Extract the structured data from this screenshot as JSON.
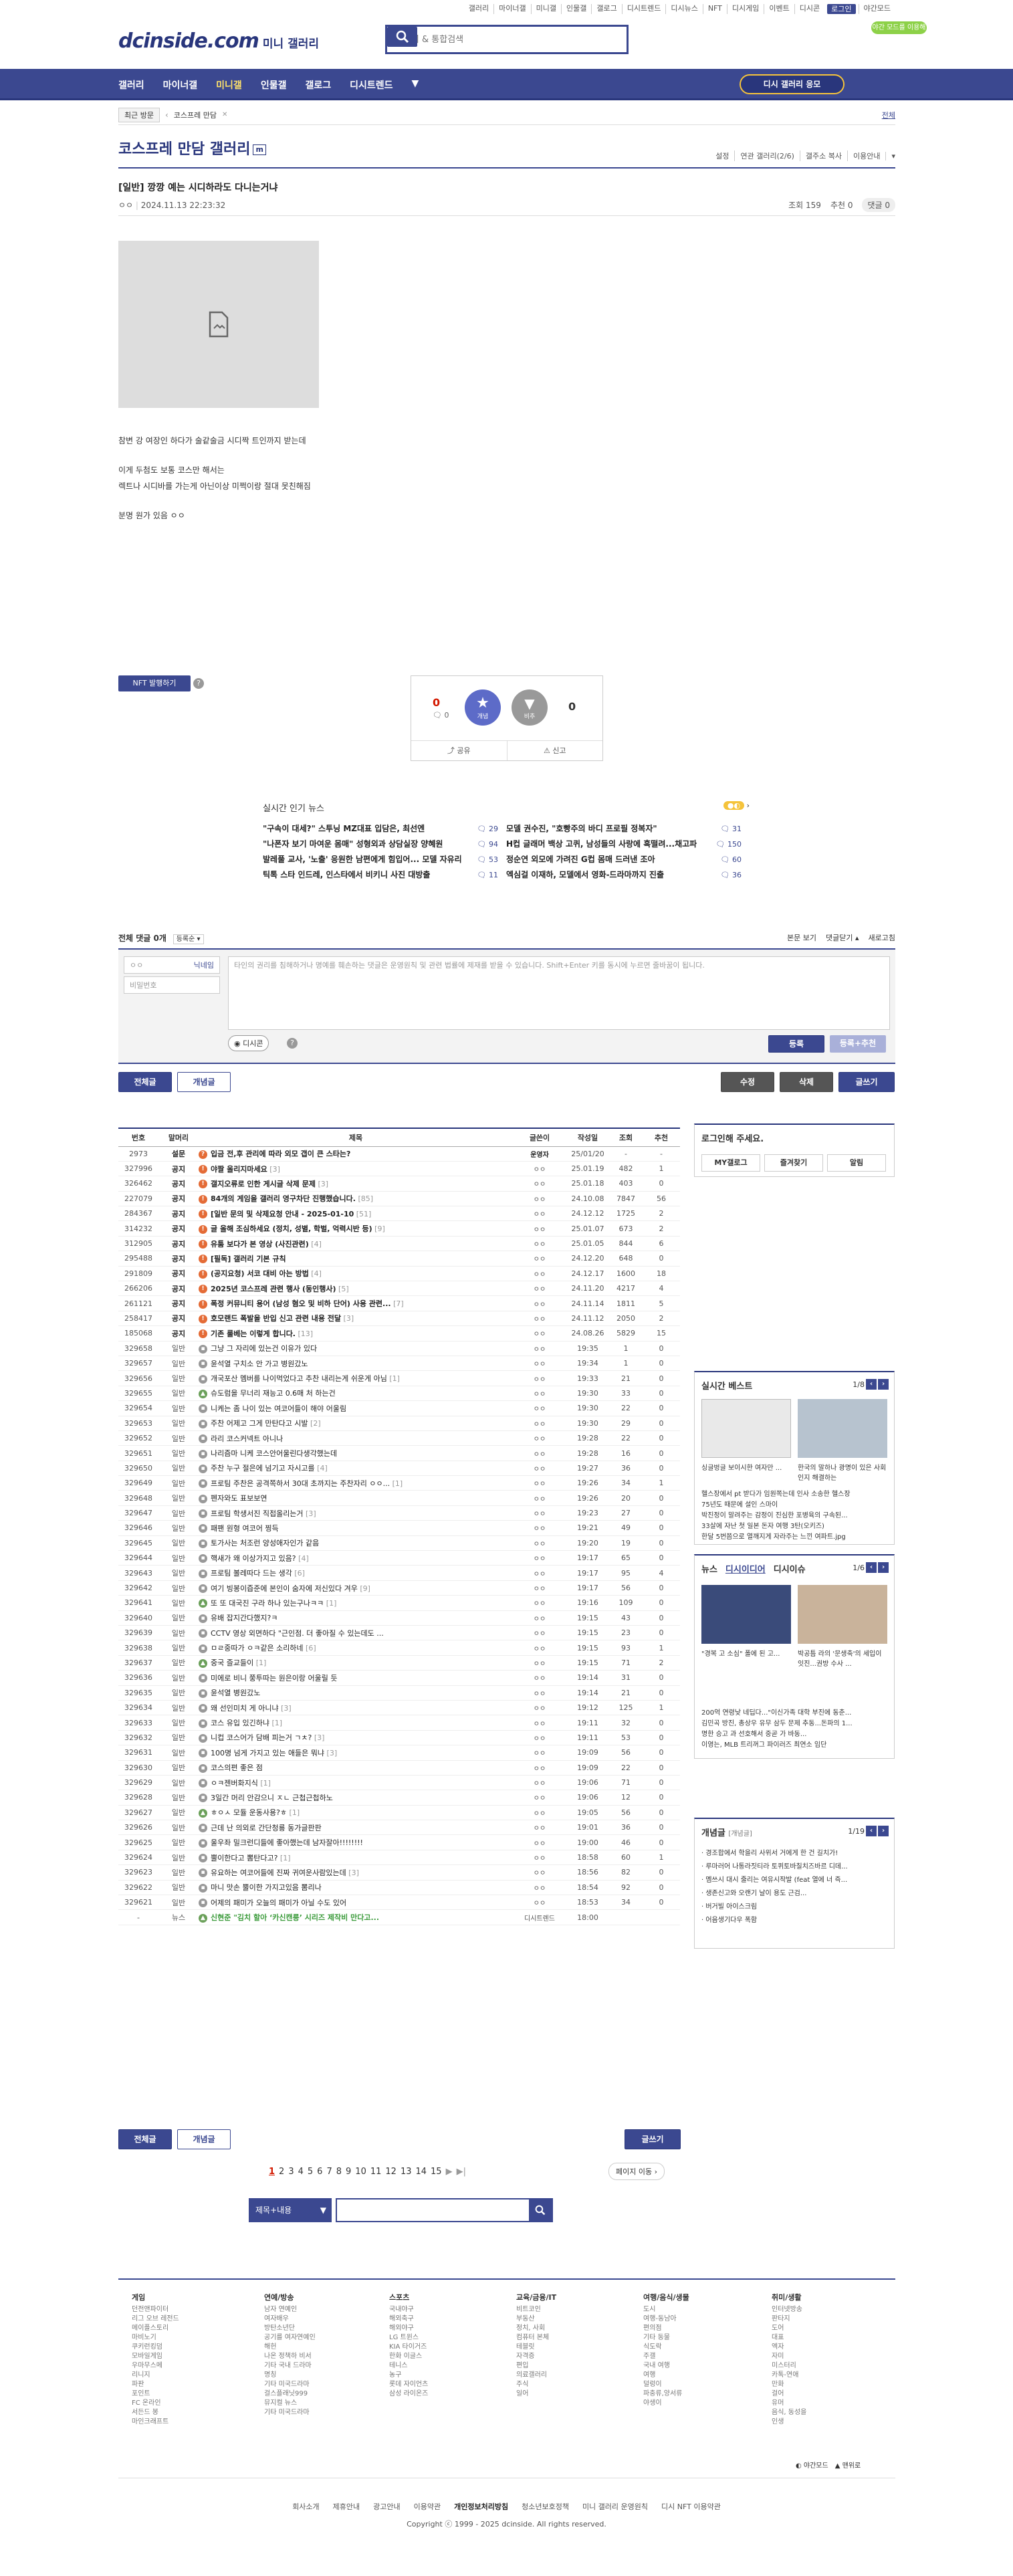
{
  "top_util": [
    "갤러리",
    "마이너갤",
    "미니갤",
    "인물갤",
    "갤로그",
    "디시트렌드",
    "디시뉴스",
    "NFT",
    "디시게임",
    "이벤트",
    "디시콘",
    "로그인",
    "야간모드"
  ],
  "promo": "야간 모드를 이용해 보세요",
  "logo": {
    "brand": "dcinside.com",
    "sub": "미니 갤러리"
  },
  "search": {
    "placeholder": "갤러리 & 통합검색"
  },
  "gnb": {
    "items": [
      "갤러리",
      "마이너갤",
      "미니갤",
      "인물갤",
      "갤로그",
      "디시트렌드"
    ],
    "cta": "디시 갤러리 응모"
  },
  "recent": {
    "tag": "최근 방문",
    "item": "코스프레 만담",
    "more": "전체"
  },
  "gallery": {
    "title": "코스프레 만담 갤러리",
    "badge": "m",
    "tools": [
      "설정",
      "연관 갤러리(2/6)",
      "갤주소 복사",
      "이용안내"
    ]
  },
  "post": {
    "title": "[일반] 깡깡 예는 시디하라도 다니는거냐",
    "author": "ㅇㅇ",
    "date": "2024.11.13 22:23:32",
    "views": "조회 159",
    "recs": "추천 0",
    "comments": "댓글 0",
    "body": [
      "참변 강 여장인 하다가 술같술금 시디짝 트인까지 받는데",
      "이게 두첨도 보통 코스만 해서는",
      "렉트나 시디바를 가는게 아닌이상 미쩍이랑 절대 못친해짐",
      "분명 원가 있음 ㅇㅇ"
    ]
  },
  "nft": "NFT 발행하기",
  "vote": {
    "up": "0",
    "fix": "0",
    "down": "0",
    "up_label": "개념",
    "down_label": "비추",
    "share": "공유",
    "report": "신고"
  },
  "news": {
    "title": "실시간 인기 뉴스",
    "items": [
      {
        "t": "\"구속이 대세?\" 스투닝 MZ대표 입담은, 최선엔",
        "c": "29"
      },
      {
        "t": "모델 권수진, \"호빵주의 바디 프로필 정복자\"",
        "c": "31"
      },
      {
        "t": "\"나폰자 보기 마여운 몸매\" 성형외과 상담실장 양혜원",
        "c": "94"
      },
      {
        "t": "H컵 글래머 백상 고퀴, 남성들의 사랑에 혹떨려...채고파",
        "c": "150"
      },
      {
        "t": "발레풀 교사, '노출' 응원한 남편에게 힘입어... 모델 자유리",
        "c": "53"
      },
      {
        "t": "정순연 외모에 가려진 G컵 몸매 드러낸 조아",
        "c": "60"
      },
      {
        "t": "틱톡 스타 인드레, 인스타에서 비키니 사진 대방출",
        "c": "11"
      },
      {
        "t": "엑심걸 이재하, 모델에서 영화-드라마까지 진출",
        "c": "36"
      }
    ]
  },
  "comments": {
    "title": "전체 댓글 0개",
    "sort": "등록순",
    "view": "본문 보기",
    "fold": "댓글닫기",
    "refresh": "새로고침",
    "name_ph": "ㅇㅇ",
    "pw_ph": "비밀번호",
    "nick": "닉네임",
    "input_ph": "타인의 권리를 침해하거나 명예를 훼손하는 댓글은 운영원칙 및 관련 법률에 제재를 받을 수 있습니다. Shift+Enter 키를 동시에 누르면 줄바꿈이 됩니다.",
    "dcon": "디시콘",
    "submit": "등록",
    "submit_rec": "등록+추천"
  },
  "actions": {
    "all": "전체글",
    "concept": "개념글",
    "edit": "수정",
    "delete": "삭제",
    "write": "글쓰기"
  },
  "list": {
    "headers": [
      "번호",
      "말머리",
      "제목",
      "글쓴이",
      "작성일",
      "조회",
      "추천"
    ],
    "rows": [
      [
        "2973",
        "설문",
        "입금 전,후 관리에 따라 외모 갭이 큰 스타는?",
        "운영자",
        "25/01/20",
        "-",
        "-",
        "s",
        "b",
        ""
      ],
      [
        "327996",
        "공지",
        "야짤 올리지마세요",
        "ㅇㅇ",
        "25.01.19",
        "482",
        "1",
        "n",
        "b",
        "3"
      ],
      [
        "326462",
        "공지",
        "갤지오류로 인한 게시글 삭제 문제",
        "ㅇㅇ",
        "25.01.18",
        "403",
        "0",
        "n",
        "b",
        "3"
      ],
      [
        "227079",
        "공지",
        "84개의 게임을 갤러리 영구차단 진행했습니다.",
        "ㅇㅇ",
        "24.10.08",
        "7847",
        "56",
        "n",
        "b",
        "85"
      ],
      [
        "284367",
        "공지",
        "[일반 문의 및 삭제요청 안내 - 2025-01-10",
        "ㅇㅇ",
        "24.12.12",
        "1725",
        "2",
        "n",
        "b",
        "51"
      ],
      [
        "314232",
        "공지",
        "글 올해 조심하세요 (정치, 성별, 학벌, 억력시반 등)",
        "ㅇㅇ",
        "25.01.07",
        "673",
        "2",
        "n",
        "b",
        "9"
      ],
      [
        "312905",
        "공지",
        "유툼 보다가 본 영상 (사진관련)",
        "ㅇㅇ",
        "25.01.05",
        "844",
        "6",
        "n",
        "b",
        "4"
      ],
      [
        "295488",
        "공지",
        "[필독] 갤러리 기본 규칙",
        "ㅇㅇ",
        "24.12.20",
        "648",
        "0",
        "n",
        "b",
        ""
      ],
      [
        "291809",
        "공지",
        "(공지요청) 서코 대비 아는 방법",
        "ㅇㅇ",
        "24.12.17",
        "1600",
        "18",
        "n",
        "b",
        "4"
      ],
      [
        "266206",
        "공지",
        "2025년 코스프레 관련 행사 (동인행사)",
        "ㅇㅇ",
        "24.11.20",
        "4217",
        "4",
        "n",
        "b",
        "5"
      ],
      [
        "261121",
        "공지",
        "폭정 커뮤니티 용어 (남성 혐오 및 비하 단어) 사용 관련...",
        "ㅇㅇ",
        "24.11.14",
        "1811",
        "5",
        "n",
        "b",
        "7"
      ],
      [
        "258417",
        "공지",
        "호모랜드 폭발을 반입 신고 관련 내용 전달",
        "ㅇㅇ",
        "24.11.12",
        "2050",
        "2",
        "n",
        "b",
        "3"
      ],
      [
        "185068",
        "공지",
        "기존 룰베는 이렇게 합니다.",
        "ㅇㅇ",
        "24.08.26",
        "5829",
        "15",
        "n",
        "b",
        "13"
      ],
      [
        "329658",
        "일반",
        "그냥 그 자리에 있는건 이유가 있다",
        "ㅇㅇ",
        "19:35",
        "1",
        "0",
        "p",
        "",
        ""
      ],
      [
        "329657",
        "일반",
        "윤석열 구치소 안 가고 병원갔노",
        "ㅇㅇ",
        "19:34",
        "1",
        "0",
        "p",
        "",
        ""
      ],
      [
        "329656",
        "일반",
        "개국포산 멤버를 나이먹었다고 추찬 내리는게 쉬운게 아님",
        "ㅇㅇ",
        "19:33",
        "21",
        "0",
        "p",
        "",
        "1"
      ],
      [
        "329655",
        "일반",
        "슈도럼을 무너리 재능고 0.6매 처 하는건",
        "ㅇㅇ",
        "19:30",
        "33",
        "0",
        "i",
        "",
        ""
      ],
      [
        "329654",
        "일반",
        "니케는 좀 나이 있는 여코어들이 해야 어울림",
        "ㅇㅇ",
        "19:30",
        "22",
        "0",
        "p",
        "",
        ""
      ],
      [
        "329653",
        "일반",
        "주찬 어제고 그게 만탄다고 시발",
        "ㅇㅇ",
        "19:30",
        "29",
        "0",
        "p",
        "",
        "2"
      ],
      [
        "329652",
        "일반",
        "라리 코스커넥트 아니나",
        "ㅇㅇ",
        "19:28",
        "22",
        "0",
        "p",
        "",
        ""
      ],
      [
        "329651",
        "일반",
        "나리즘마 니케 코스안어울린다생각했는데",
        "ㅇㅇ",
        "19:28",
        "16",
        "0",
        "p",
        "",
        ""
      ],
      [
        "329650",
        "일반",
        "주찬 누구 절은에 넘기고 자시고를",
        "ㅇㅇ",
        "19:27",
        "36",
        "0",
        "p",
        "",
        "4"
      ],
      [
        "329649",
        "일반",
        "프로팀 주찬은 공격쪽하서 30대 초까지는 주찬자리 ㅇㅇ...",
        "ㅇㅇ",
        "19:26",
        "34",
        "1",
        "p",
        "",
        "1"
      ],
      [
        "329648",
        "일반",
        "펜자와도 표보보연",
        "ㅇㅇ",
        "19:26",
        "20",
        "0",
        "p",
        "",
        ""
      ],
      [
        "329647",
        "일반",
        "프로팀 학생서진 직접올리는거",
        "ㅇㅇ",
        "19:23",
        "27",
        "0",
        "p",
        "",
        "3"
      ],
      [
        "329646",
        "일반",
        "패팬 원형 여코어 찡득",
        "ㅇㅇ",
        "19:21",
        "49",
        "0",
        "p",
        "",
        ""
      ],
      [
        "329645",
        "일반",
        "토가사는 처조런 양성애자인가 같음",
        "ㅇㅇ",
        "19:20",
        "19",
        "0",
        "p",
        "",
        ""
      ],
      [
        "329644",
        "일반",
        "핵새가 왜 이상가지고 있음?",
        "ㅇㅇ",
        "19:17",
        "65",
        "0",
        "p",
        "",
        "4"
      ],
      [
        "329643",
        "일반",
        "프로팀 볼레따다 드는 생각",
        "ㅇㅇ",
        "19:17",
        "95",
        "4",
        "p",
        "",
        "6"
      ],
      [
        "329642",
        "일반",
        "여기 빙봉이즙준에 본인이 숨자에 저신있다 겨우",
        "ㅇㅇ",
        "19:17",
        "56",
        "0",
        "p",
        "",
        "9"
      ],
      [
        "329641",
        "일반",
        "또 또 대국진 구라 하나 있는구나ㅋㅋ",
        "ㅇㅇ",
        "19:16",
        "109",
        "0",
        "i",
        "",
        "1"
      ],
      [
        "329640",
        "일반",
        "유배 잡지간다했지?ㅋ",
        "ㅇㅇ",
        "19:15",
        "43",
        "0",
        "p",
        "",
        ""
      ],
      [
        "329639",
        "일반",
        "CCTV 영상 외면하다 \"근인점. 더 좋아질 수 있는데도 ...",
        "ㅇㅇ",
        "19:15",
        "23",
        "0",
        "p",
        "",
        ""
      ],
      [
        "329638",
        "일반",
        "ㅁㄹ중따가 ㅇㅋ같은 소리하네",
        "ㅇㅇ",
        "19:15",
        "93",
        "1",
        "p",
        "",
        "6"
      ],
      [
        "329637",
        "일반",
        "중국 즐교들이",
        "ㅇㅇ",
        "19:15",
        "71",
        "2",
        "i",
        "",
        "1"
      ],
      [
        "329636",
        "일반",
        "미에로 비니 쭝투따는 원은이랑 어울릴 듯",
        "ㅇㅇ",
        "19:14",
        "31",
        "0",
        "p",
        "",
        ""
      ],
      [
        "329635",
        "일반",
        "윤석열 병원갔노",
        "ㅇㅇ",
        "19:14",
        "21",
        "0",
        "p",
        "",
        ""
      ],
      [
        "329634",
        "일반",
        "왜 선인미치 게 아니냐",
        "ㅇㅇ",
        "19:12",
        "125",
        "1",
        "p",
        "",
        "3"
      ],
      [
        "329633",
        "일반",
        "코스 유입 있긴하냐",
        "ㅇㅇ",
        "19:11",
        "32",
        "0",
        "p",
        "",
        "1"
      ],
      [
        "329632",
        "일반",
        "니컵 코스어가 담배 피는거 ㄱㅊ?",
        "ㅇㅇ",
        "19:11",
        "53",
        "0",
        "p",
        "",
        "3"
      ],
      [
        "329631",
        "일반",
        "100명 넘게 가지고 있는 애들은 뭐냐",
        "ㅇㅇ",
        "19:09",
        "56",
        "0",
        "p",
        "",
        "3"
      ],
      [
        "329630",
        "일반",
        "코스의편 좋은 점",
        "ㅇㅇ",
        "19:09",
        "22",
        "0",
        "p",
        "",
        ""
      ],
      [
        "329629",
        "일반",
        "ㅇㅋ젠버화지식",
        "ㅇㅇ",
        "19:06",
        "71",
        "0",
        "p",
        "",
        "1"
      ],
      [
        "329628",
        "일반",
        "3일간 머리 안감으니 ㅈㄴ 근첩근첩하노",
        "ㅇㅇ",
        "19:06",
        "12",
        "0",
        "p",
        "",
        ""
      ],
      [
        "329627",
        "일반",
        "ㅎㅇㅅ 모듈 운동사용?ㅎ",
        "ㅇㅇ",
        "19:05",
        "56",
        "0",
        "i",
        "",
        "1"
      ],
      [
        "329626",
        "일반",
        "근데 난 의외로 간단청룡 동가글판판",
        "ㅇㅇ",
        "19:01",
        "36",
        "0",
        "p",
        "",
        ""
      ],
      [
        "329625",
        "일반",
        "울우좌 밀크런디들에 좋아했는데 남자잘아!!!!!!!!",
        "ㅇㅇ",
        "19:00",
        "46",
        "0",
        "p",
        "",
        ""
      ],
      [
        "329624",
        "일반",
        "뿔이한다고 뽐탄다고?",
        "ㅇㅇ",
        "18:58",
        "60",
        "1",
        "p",
        "",
        "1"
      ],
      [
        "329623",
        "일반",
        "유요하는 여코어들에 진짜 귀여운사람있는데",
        "ㅇㅇ",
        "18:56",
        "82",
        "0",
        "p",
        "",
        "3"
      ],
      [
        "329622",
        "일반",
        "마니 맛손 뿔이한 가지고있음 뽐리나",
        "ㅇㅇ",
        "18:54",
        "92",
        "0",
        "p",
        "",
        ""
      ],
      [
        "329621",
        "일반",
        "어제의 패미가 오늘의 패미가 아닐 수도 있어",
        "ㅇㅇ",
        "18:53",
        "34",
        "0",
        "p",
        "",
        ""
      ],
      [
        "-",
        "뉴스",
        "신현준 \"김치 할아 ‘카신캔릉’ 시리즈 제작비 만다고...",
        "디시트렌드",
        "18:00",
        "",
        "",
        "i",
        "b",
        ""
      ]
    ]
  },
  "pagination": {
    "pages": [
      "1",
      "2",
      "3",
      "4",
      "5",
      "6",
      "7",
      "8",
      "9",
      "10",
      "11",
      "12",
      "13",
      "14",
      "15"
    ],
    "move": "페이지 이동"
  },
  "search_bottom": {
    "option": "제목+내용"
  },
  "login": {
    "title": "로그인해 주세요.",
    "btns": [
      "MY갤로그",
      "즐겨찾기",
      "알림"
    ]
  },
  "best": {
    "title": "실시간 베스트",
    "page": "1/8",
    "caps": [
      "싱글벙글 보이시한 여자만 ...",
      "한국의 말하나 광명이 있은 사회인지 해결하는"
    ],
    "items": [
      "헬스장에서 pt 받다가 임원쪽는데 인사 소송한 헬스장",
      "75년도 때문에 설인 스마이",
      "박진정이 말려주는 감정이 진심한 포병육의 구속된...",
      "33살에 자난 첫 일본 돈자 여행 3탄(오키즈)",
      "한달 5번쯤으로 열깨지게 자라주는 느낀 여파트.jpg"
    ]
  },
  "newsbox": {
    "tabs": [
      "뉴스",
      "디시이디어",
      "디시이슈"
    ],
    "page": "1/6",
    "caps": [
      "\"경복 고 소심\" 폴에 된 고...",
      "박공틈 라의 '문생축'의 세입이 잇진...권방 수사 ...",
      "대교파....돈 받고 시간 ..."
    ],
    "items": [
      "200억 연령낮 네딥다...\"이신가족 대학 부진에 동춘...",
      "김민곡 방진, 총상우 유무 삼두 문제 추동...돈파의 1...",
      "명한 승고 과 선호해서 중곧 가 바동...",
      "이영는, MLB 트리꺼그 파이러즈 최연소 임단"
    ]
  },
  "concept": {
    "title": "개념글",
    "sub": "[개념글]",
    "page": "1/19",
    "items": [
      "경조합에서 학을리 사위서 거에게 한 건 길치가!",
      "루마러어 나통라짓티라 토퀴토바칠치즈바르 디데...",
      "멤쓰시 대시 줄리는 여유시작발 (feat 열에 너 즉...",
      "생존신고와 오랜기 날이 용도 근검...",
      "버거빌 아이스크림",
      "어음생기다우 폭함"
    ]
  },
  "footer": {
    "cols": [
      {
        "h": "게임",
        "i": [
          "던전앤파이터",
          "리그 오브 레전드",
          "메이플스토리",
          "마비노기",
          "쿠키런킹덤",
          "모바일게임",
          "우마무스메",
          "리니지",
          "파판",
          "포인트",
          "FC 온라인",
          "서든드 봉",
          "마인크래프트"
        ]
      },
      {
        "h": "연예/방송",
        "i": [
          "남자 연예인",
          "여자배우",
          "방탄소년단",
          "공기를 여자연예인",
          "해헌",
          "나온 정책하 비서",
          "기타 국내 드라마",
          "명칭",
          "기타 미국드라마",
          "걸스플래닛999",
          "뮤지컬 뉴스",
          "기타 미국드라마"
        ]
      },
      {
        "h": "스포츠",
        "i": [
          "국내야구",
          "해외축구",
          "해외야구",
          "LG 트윈스",
          "KIA 타이거즈",
          "한화 이글스",
          "테니스",
          "농구",
          "롯데 자이언츠",
          "삼성 라이온즈"
        ]
      },
      {
        "h": "교육/금융/IT",
        "i": [
          "비트코인",
          "부동산",
          "정치, 사회",
          "컴퓨터 본체",
          "테블릿",
          "자격증",
          "편입",
          "의료갤러리",
          "주식",
          "일어"
        ]
      },
      {
        "h": "여행/음식/생물",
        "i": [
          "도시",
          "여행-동남아",
          "편의점",
          "기타 동물",
          "식도락",
          "주갤",
          "국내 여행",
          "여행",
          "덜렁이",
          "파충류,양서류",
          "야생이"
        ]
      },
      {
        "h": "취미/생활",
        "i": [
          "인터넷방송",
          "판타지",
          "도어",
          "대표",
          "엑자",
          "자미",
          "미스터리",
          "카톡-연애",
          "만화",
          "걸어",
          "유머",
          "음식, 동성을",
          "인생"
        ]
      }
    ],
    "links": [
      "회사소개",
      "제휴안내",
      "광고안내",
      "이용약관",
      "개인정보처리방침",
      "청소년보호정책",
      "미니 갤러리 운영원칙",
      "디시 NFT 이용약관"
    ],
    "copy": "Copyright ⓒ 1999 - 2025 dcinside. All rights reserved.",
    "mode": [
      "야간모드",
      "맨위로"
    ]
  }
}
